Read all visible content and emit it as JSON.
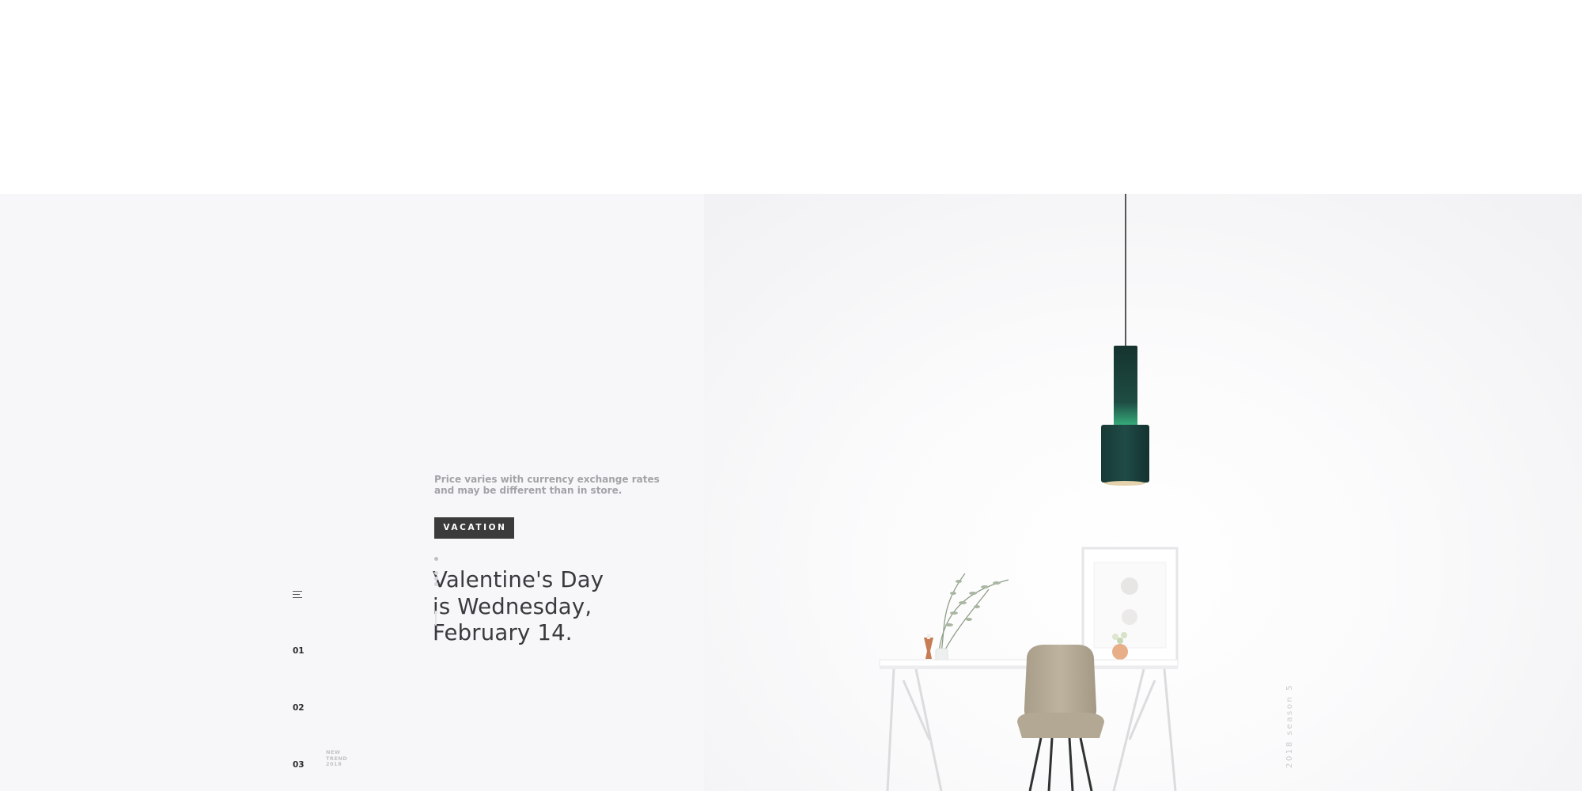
{
  "hero": {
    "headline": [
      "Valentine's Day",
      "is Wednesday,",
      "February 14."
    ],
    "subtext": [
      "Price varies with currency exchange rates",
      "and may be different than in store."
    ],
    "cta_label": "VACATION"
  },
  "sidebar": {
    "menu_icon": "hamburger-menu-icon",
    "slides": [
      "01",
      "02",
      "03"
    ],
    "trend_tag": [
      "NEW",
      "TREND",
      "2018"
    ]
  },
  "season_label": "2018 season 5",
  "colors": {
    "text_dark": "#3a3a3e",
    "text_muted": "#a3a3a8",
    "button_bg": "#3b3b3b",
    "hero_bg": "#f7f7f9",
    "lamp_green": "#1d4a44"
  }
}
